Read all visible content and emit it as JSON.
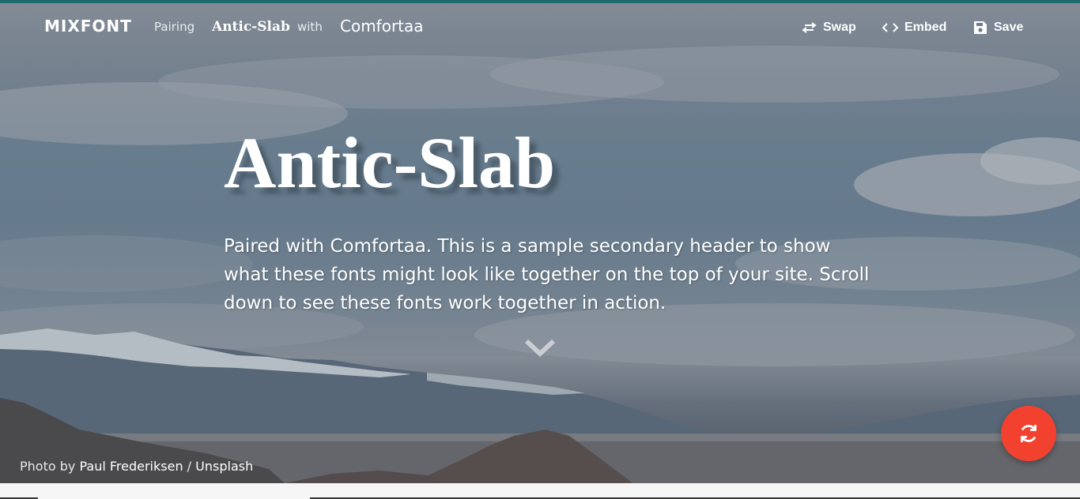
{
  "nav": {
    "logo": "MIXFONT",
    "pairing_label": "Pairing",
    "primary_font": "Antic-Slab",
    "with_label": "with",
    "secondary_font": "Comfortaa",
    "actions": [
      {
        "label": "Swap",
        "icon": "swap-icon"
      },
      {
        "label": "Embed",
        "icon": "code-icon"
      },
      {
        "label": "Save",
        "icon": "save-icon"
      }
    ]
  },
  "hero": {
    "headline": "Antic-Slab",
    "subheading": "Paired with Comfortaa. This is a sample secondary header to show what these fonts might look like together on the top of your site. Scroll down to see these fonts work together in action.",
    "scroll_icon": "chevron-down-icon"
  },
  "credit": {
    "prefix": "Photo by",
    "author": "Paul Frederiksen",
    "separator": "/",
    "source": "Unsplash"
  },
  "fab": {
    "icon": "refresh-icon"
  },
  "colors": {
    "top_strip": "#1f6a6e",
    "fab": "#f2412f",
    "text": "#ffffff"
  }
}
